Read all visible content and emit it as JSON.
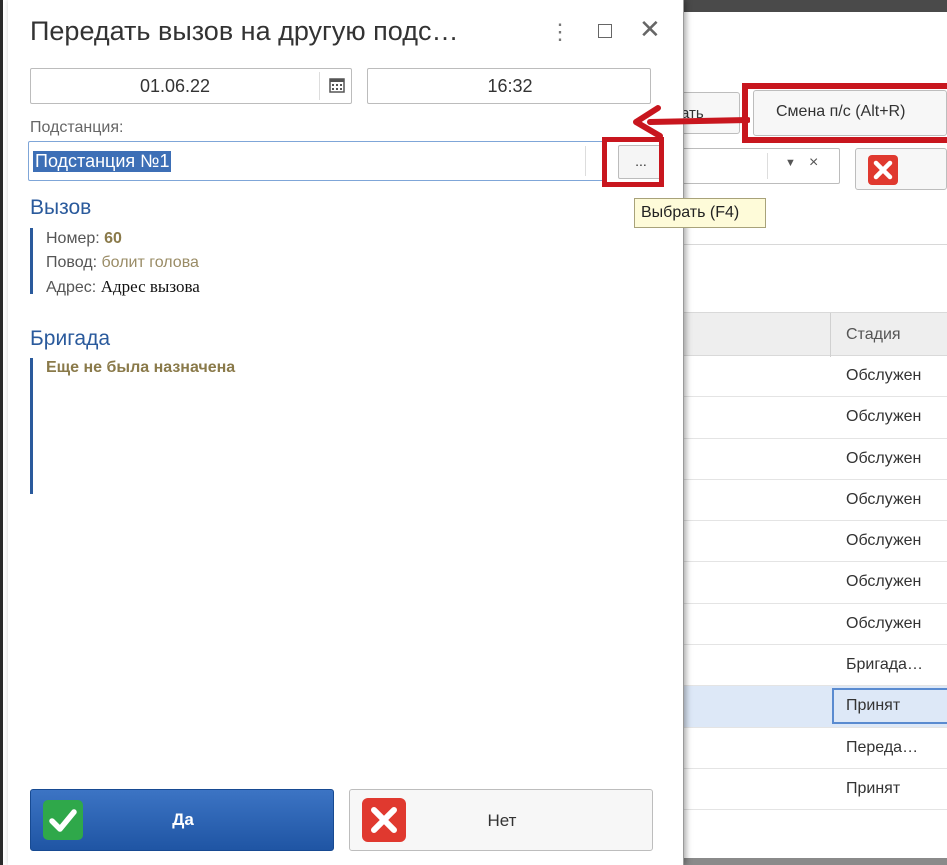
{
  "dialog": {
    "title": "Передать вызов на другую подс…",
    "date": "01.06.22",
    "time": "16:32",
    "substation_label": "Подстанция:",
    "substation_value": "Подстанция №1",
    "choose_button": "...",
    "call_section": {
      "title": "Вызов",
      "number_label": "Номер:",
      "number_value": "60",
      "reason_label": "Повод:",
      "reason_value": "болит голова",
      "address_label": "Адрес:",
      "address_value": "Адрес вызова"
    },
    "brigade_section": {
      "title": "Бригада",
      "note": "Еще не была назначена"
    },
    "yes_button": "Да",
    "no_button": "Нет"
  },
  "tooltip": "Выбрать (F4)",
  "background": {
    "left_button_partial": "ать",
    "smena_button": "Смена п/с (Alt+R)",
    "table": {
      "column_header": "Стадия",
      "rows": [
        "Обслужен",
        "Обслужен",
        "Обслужен",
        "Обслужен",
        "Обслужен",
        "Обслужен",
        "Обслужен",
        "Бригада…",
        "Принят",
        "Переда…",
        "Принят"
      ],
      "selected_row_index": 8
    }
  },
  "colors": {
    "accent_blue": "#2a5a9c",
    "annotation_red": "#c8161e",
    "yes_button": "#2a62b4",
    "selection": "#3d6fb6"
  },
  "icons": {
    "check": "check-icon",
    "cross": "cross-icon",
    "calendar": "calendar-icon",
    "more": "more-vertical-icon",
    "maximize": "maximize-icon",
    "close": "close-icon"
  }
}
